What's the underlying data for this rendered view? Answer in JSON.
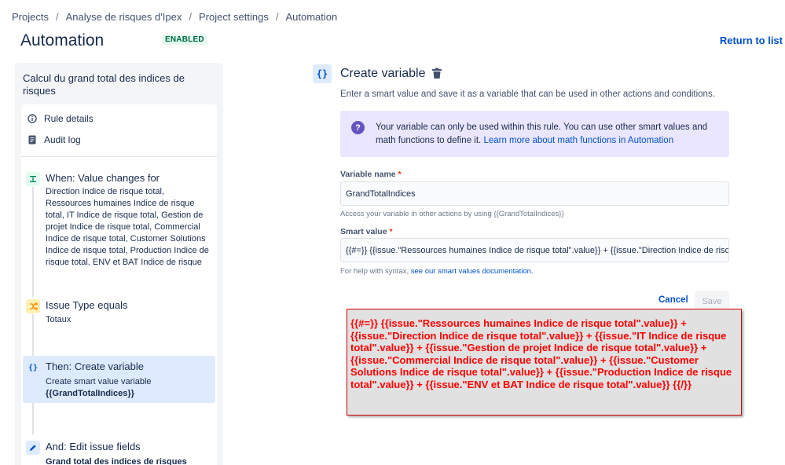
{
  "breadcrumb": {
    "items": [
      "Projects",
      "Analyse de risques d'Ipex",
      "Project settings",
      "Automation"
    ],
    "separator": "/"
  },
  "header": {
    "title": "Automation",
    "status_badge": "ENABLED",
    "return_link": "Return to list"
  },
  "sidebar": {
    "rule_name": "Calcul du grand total des indices de risques",
    "menu": [
      {
        "label": "Rule details",
        "icon": "info-icon"
      },
      {
        "label": "Audit log",
        "icon": "document-icon"
      }
    ],
    "components": [
      {
        "title": "When: Value changes for",
        "icon": "trigger-icon",
        "description": "Direction Indice de risque total, Ressources humaines Indice de risque total, IT Indice de risque total, Gestion de projet Indice de risque total, Commercial Indice de risque total, Customer Solutions Indice de risque total, Production Indice de risque total, ENV et BAT Indice de risque total"
      },
      {
        "title": "Issue Type equals",
        "icon": "shuffle-icon",
        "description": "Totaux"
      },
      {
        "title": "Then: Create variable",
        "icon": "braces-icon",
        "description": "Create smart value variable",
        "description_bold": "{{GrandTotalIndices}}"
      },
      {
        "title": "And: Edit issue fields",
        "icon": "pencil-icon",
        "description_bold": "Grand total des indices de risques"
      }
    ]
  },
  "panel": {
    "icon_glyph": "{}",
    "title": "Create variable",
    "subtitle": "Enter a smart value and save it as a variable that can be used in other actions and conditions.",
    "info": {
      "text": "Your variable can only be used within this rule. You can use other smart values and math functions to define it. ",
      "link": "Learn more about math functions in Automation"
    },
    "variable_name": {
      "label": "Variable name",
      "required_mark": "*",
      "value": "GrandTotalIndices",
      "helper": "Access your variable in other actions by using {{GrandTotalIndices}}"
    },
    "smart_value": {
      "label": "Smart value",
      "required_mark": "*",
      "value": "{{#=}} {{issue.\"Ressources humaines Indice de risque total\".value}} + {{issue.\"Direction Indice de risque total\".value}}",
      "helper_prefix": "For help with syntax, ",
      "helper_link": "see our smart values documentation."
    },
    "cancel_label": "Cancel",
    "save_label": "Save"
  },
  "annotation": {
    "text": "{{#=}} {{issue.\"Ressources humaines Indice de risque total\".value}} + {{issue.\"Direction Indice de risque total\".value}} + {{issue.\"IT Indice de risque total\".value}} + {{issue.\"Gestion de projet Indice de risque total\".value}} + {{issue.\"Commercial Indice de risque total\".value}} + {{issue.\"Customer Solutions Indice de risque total\".value}} + {{issue.\"Production Indice de risque total\".value}} + {{issue.\"ENV et BAT Indice de risque total\".value}} {{/}}"
  },
  "colors": {
    "link": "#0052cc",
    "info_bg": "#eae6ff",
    "info_icon": "#6554c0",
    "enabled_text": "#006644",
    "enabled_bg": "#e3fcef",
    "active_component_bg": "#deebff",
    "annotation_text": "#ff0000",
    "annotation_border": "#d40000"
  }
}
